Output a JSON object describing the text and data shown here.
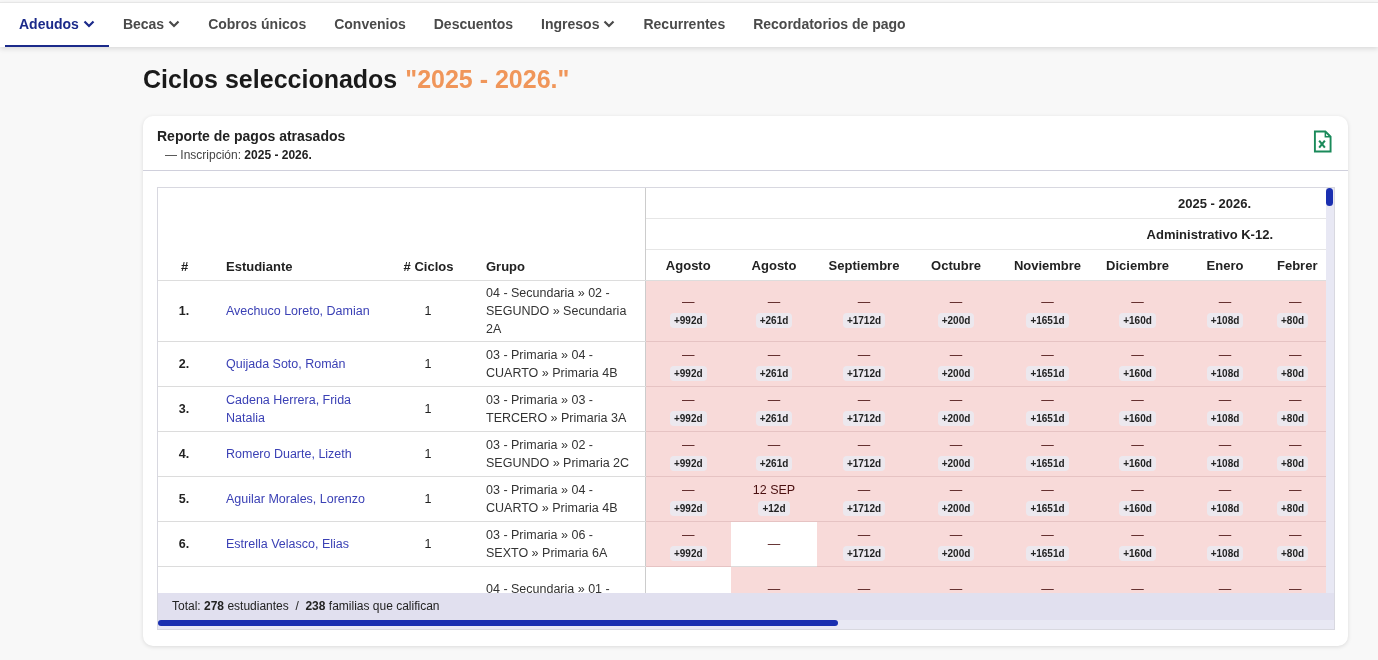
{
  "nav": {
    "tabs": [
      {
        "label": "Adeudos",
        "selected": true,
        "dropdown": true
      },
      {
        "label": "Becas",
        "selected": false,
        "dropdown": true
      },
      {
        "label": "Cobros únicos",
        "selected": false,
        "dropdown": false
      },
      {
        "label": "Convenios",
        "selected": false,
        "dropdown": false
      },
      {
        "label": "Descuentos",
        "selected": false,
        "dropdown": false
      },
      {
        "label": "Ingresos",
        "selected": false,
        "dropdown": true
      },
      {
        "label": "Recurrentes",
        "selected": false,
        "dropdown": false
      },
      {
        "label": "Recordatorios de pago",
        "selected": false,
        "dropdown": false
      }
    ]
  },
  "page": {
    "title": "Ciclos seleccionados",
    "cycle": "\"2025 - 2026.\""
  },
  "report": {
    "title": "Reporte de pagos atrasados",
    "subtitle": "— Inscripción: **2025 - 2026.**",
    "table": {
      "columns": [
        "#",
        "Estudiante",
        "# Ciclos",
        "Grupo"
      ],
      "cycle": "2025 - 2026.",
      "plan": "Administrativo K-12.",
      "months": [
        "Agosto",
        "Agosto",
        "Septiembre",
        "Octubre",
        "Noviembre",
        "Diciembre",
        "Enero",
        "Febrer"
      ],
      "rows": [
        {
          "number": "1.",
          "student": "Avechuco Loreto, Damian",
          "cycles": "1",
          "group": "04 - Secundaria » 02 - SEGUNDO » Secundaria 2A",
          "cells": [
            {
              "kind": "overdue",
              "value": "—",
              "badge": "+992d"
            },
            {
              "kind": "overdue",
              "value": "—",
              "badge": "+261d"
            },
            {
              "kind": "overdue",
              "value": "—",
              "badge": "+1712d"
            },
            {
              "kind": "overdue",
              "value": "—",
              "badge": "+200d"
            },
            {
              "kind": "overdue",
              "value": "—",
              "badge": "+1651d"
            },
            {
              "kind": "overdue",
              "value": "—",
              "badge": "+160d"
            },
            {
              "kind": "overdue",
              "value": "—",
              "badge": "+108d"
            },
            {
              "kind": "overdue",
              "value": "—",
              "badge": "+80d"
            }
          ]
        },
        {
          "number": "2.",
          "student": "Quijada Soto, Román",
          "cycles": "1",
          "group": "03 - Primaria » 04 - CUARTO » Primaria 4B",
          "cells": [
            {
              "kind": "overdue",
              "value": "—",
              "badge": "+992d"
            },
            {
              "kind": "overdue",
              "value": "—",
              "badge": "+261d"
            },
            {
              "kind": "overdue",
              "value": "—",
              "badge": "+1712d"
            },
            {
              "kind": "overdue",
              "value": "—",
              "badge": "+200d"
            },
            {
              "kind": "overdue",
              "value": "—",
              "badge": "+1651d"
            },
            {
              "kind": "overdue",
              "value": "—",
              "badge": "+160d"
            },
            {
              "kind": "overdue",
              "value": "—",
              "badge": "+108d"
            },
            {
              "kind": "overdue",
              "value": "—",
              "badge": "+80d"
            }
          ]
        },
        {
          "number": "3.",
          "student": "Cadena Herrera, Frida Natalia",
          "cycles": "1",
          "group": "03 - Primaria » 03 - TERCERO » Primaria 3A",
          "cells": [
            {
              "kind": "overdue",
              "value": "—",
              "badge": "+992d"
            },
            {
              "kind": "overdue",
              "value": "—",
              "badge": "+261d"
            },
            {
              "kind": "overdue",
              "value": "—",
              "badge": "+1712d"
            },
            {
              "kind": "overdue",
              "value": "—",
              "badge": "+200d"
            },
            {
              "kind": "overdue",
              "value": "—",
              "badge": "+1651d"
            },
            {
              "kind": "overdue",
              "value": "—",
              "badge": "+160d"
            },
            {
              "kind": "overdue",
              "value": "—",
              "badge": "+108d"
            },
            {
              "kind": "overdue",
              "value": "—",
              "badge": "+80d"
            }
          ]
        },
        {
          "number": "4.",
          "student": "Romero Duarte, Lizeth",
          "cycles": "1",
          "group": "03 - Primaria » 02 - SEGUNDO » Primaria 2C",
          "cells": [
            {
              "kind": "overdue",
              "value": "—",
              "badge": "+992d"
            },
            {
              "kind": "overdue",
              "value": "—",
              "badge": "+261d"
            },
            {
              "kind": "overdue",
              "value": "—",
              "badge": "+1712d"
            },
            {
              "kind": "overdue",
              "value": "—",
              "badge": "+200d"
            },
            {
              "kind": "overdue",
              "value": "—",
              "badge": "+1651d"
            },
            {
              "kind": "overdue",
              "value": "—",
              "badge": "+160d"
            },
            {
              "kind": "overdue",
              "value": "—",
              "badge": "+108d"
            },
            {
              "kind": "overdue",
              "value": "—",
              "badge": "+80d"
            }
          ]
        },
        {
          "number": "5.",
          "student": "Aguilar Morales, Lorenzo",
          "cycles": "1",
          "group": "03 - Primaria » 04 - CUARTO » Primaria 4B",
          "cells": [
            {
              "kind": "overdue",
              "value": "—",
              "badge": "+992d"
            },
            {
              "kind": "overdue",
              "value": "12 SEP",
              "badge": "+12d"
            },
            {
              "kind": "overdue",
              "value": "—",
              "badge": "+1712d"
            },
            {
              "kind": "overdue",
              "value": "—",
              "badge": "+200d"
            },
            {
              "kind": "overdue",
              "value": "—",
              "badge": "+1651d"
            },
            {
              "kind": "overdue",
              "value": "—",
              "badge": "+160d"
            },
            {
              "kind": "overdue",
              "value": "—",
              "badge": "+108d"
            },
            {
              "kind": "overdue",
              "value": "—",
              "badge": "+80d"
            }
          ]
        },
        {
          "number": "6.",
          "student": "Estrella Velasco, Elias",
          "cycles": "1",
          "group": "03 - Primaria » 06 - SEXTO » Primaria 6A",
          "cells": [
            {
              "kind": "overdue",
              "value": "—",
              "badge": "+992d"
            },
            {
              "kind": "clear",
              "value": "—"
            },
            {
              "kind": "overdue",
              "value": "—",
              "badge": "+1712d"
            },
            {
              "kind": "overdue",
              "value": "—",
              "badge": "+200d"
            },
            {
              "kind": "overdue",
              "value": "—",
              "badge": "+1651d"
            },
            {
              "kind": "overdue",
              "value": "—",
              "badge": "+160d"
            },
            {
              "kind": "overdue",
              "value": "—",
              "badge": "+108d"
            },
            {
              "kind": "overdue",
              "value": "—",
              "badge": "+80d"
            }
          ]
        },
        {
          "group": "04 - Secundaria » 01 -",
          "cells": [
            {
              "kind": "clear"
            },
            {
              "kind": "overdue",
              "value": "—"
            },
            {
              "kind": "overdue",
              "value": "—"
            },
            {
              "kind": "overdue",
              "value": "—"
            },
            {
              "kind": "overdue",
              "value": "—"
            },
            {
              "kind": "overdue",
              "value": "—"
            },
            {
              "kind": "overdue",
              "value": "—"
            },
            {
              "kind": "overdue",
              "value": "—"
            }
          ]
        }
      ]
    },
    "total": "Total: **278** estudiantes  /  **238** familias que califican"
  }
}
